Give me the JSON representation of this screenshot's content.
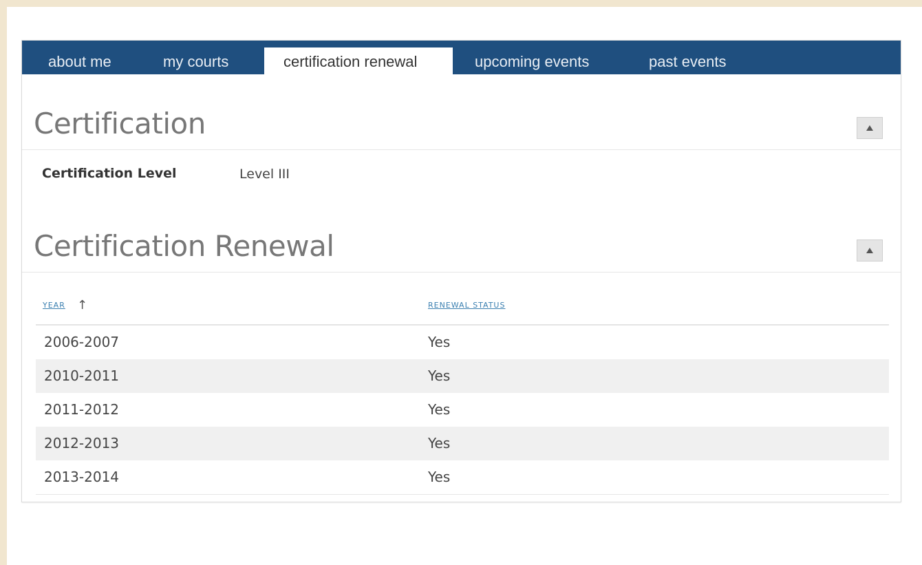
{
  "tabs": [
    {
      "label": "about me",
      "active": false
    },
    {
      "label": "my courts",
      "active": false
    },
    {
      "label": "certification renewal",
      "active": true
    },
    {
      "label": "upcoming events",
      "active": false
    },
    {
      "label": "past events",
      "active": false
    }
  ],
  "certification": {
    "title": "Certification",
    "level_label": "Certification Level",
    "level_value": "Level III",
    "collapse_icon": "triangle-up-icon"
  },
  "renewal": {
    "title": "Certification Renewal",
    "collapse_icon": "triangle-up-icon",
    "columns": {
      "year": "YEAR",
      "status": "RENEWAL STATUS"
    },
    "sort": {
      "column": "year",
      "direction": "ascending",
      "icon": "↑"
    },
    "rows": [
      {
        "year": "2006-2007",
        "status": "Yes"
      },
      {
        "year": "2010-2011",
        "status": "Yes"
      },
      {
        "year": "2011-2012",
        "status": "Yes"
      },
      {
        "year": "2012-2013",
        "status": "Yes"
      },
      {
        "year": "2013-2014",
        "status": "Yes"
      }
    ]
  },
  "colors": {
    "tabbar": "#1f4f7f",
    "link": "#3a7fb0",
    "background": "#f1e6cf"
  }
}
